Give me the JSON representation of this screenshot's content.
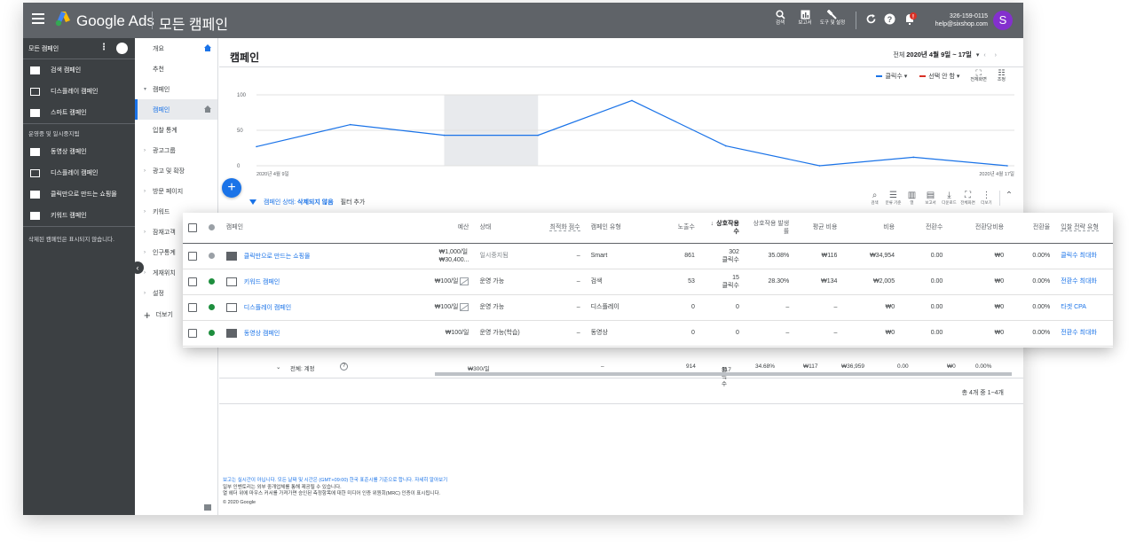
{
  "topbar": {
    "brand": "Google Ads",
    "page": "모든 캠페인",
    "tools": [
      {
        "label": "검색"
      },
      {
        "label": "보고서"
      },
      {
        "label": "도구 및 설정"
      }
    ],
    "account_id": "326-159-0115",
    "account_email": "help@sixshop.com",
    "avatar_letter": "S",
    "colors": {
      "bar": "#5f6368",
      "avatar": "#8430ce",
      "notify": "#d93025"
    }
  },
  "sidebar": {
    "header": "모든 캠페인",
    "items": [
      {
        "label": "검색 캠페인",
        "icon": "search-campaign-icon"
      },
      {
        "label": "디스플레이 캠페인",
        "icon": "display-campaign-icon"
      },
      {
        "label": "스마트 캠페인",
        "icon": "smart-campaign-icon"
      }
    ],
    "section": "운영중 및 일시중지됨",
    "section_items": [
      {
        "label": "동영상 캠페인",
        "icon": "video-campaign-icon"
      },
      {
        "label": "디스플레이 캠페인",
        "icon": "display-campaign-icon"
      },
      {
        "label": "클릭만으로 만드는 쇼핑몰",
        "icon": "smart-campaign-icon"
      },
      {
        "label": "키워드 캠페인",
        "icon": "search-campaign-icon"
      }
    ],
    "note": "삭제된 캠페인은 표시되지 않습니다."
  },
  "nav": {
    "items": [
      {
        "label": "개요",
        "type": "top"
      },
      {
        "label": "추천",
        "type": "top"
      },
      {
        "label": "캠페인",
        "type": "group"
      },
      {
        "label": "캠페인",
        "type": "active"
      },
      {
        "label": "입찰 통계",
        "type": "sub"
      },
      {
        "label": "광고그룹",
        "type": "group"
      },
      {
        "label": "광고 및 확장",
        "type": "group"
      },
      {
        "label": "방문 페이지",
        "type": "group"
      },
      {
        "label": "키워드",
        "type": "group"
      },
      {
        "label": "잠재고객",
        "type": "group"
      },
      {
        "label": "인구통계",
        "type": "group"
      },
      {
        "label": "게재위치",
        "type": "group"
      },
      {
        "label": "설정",
        "type": "group"
      }
    ],
    "more": "더보기"
  },
  "main": {
    "title": "캠페인",
    "date_prefix": "전체",
    "date_range": "2020년 4월 9일 ~ 17일",
    "legend": {
      "metric1": "클릭수",
      "metric2": "선택 안 함",
      "tool1": "전체화면",
      "tool2": "조정"
    },
    "filter_label": "캠페인 상태:",
    "filter_value": "삭제되지 않음",
    "filter_add": "필터 추가",
    "filter_tools": [
      {
        "glyph": "⌕",
        "label": "검색"
      },
      {
        "glyph": "☰",
        "label": "분류 기준"
      },
      {
        "glyph": "▥",
        "label": "열"
      },
      {
        "glyph": "▤",
        "label": "보고서"
      },
      {
        "glyph": "⤓",
        "label": "다운로드"
      },
      {
        "glyph": "⛶",
        "label": "전체화면"
      },
      {
        "glyph": "⋮",
        "label": "더보기"
      }
    ],
    "totals": {
      "label": "전체: 계정",
      "budget": "₩300/일",
      "opt": "–",
      "impr": "914",
      "inter": "317",
      "inter_unit": "클릭수",
      "rate": "34.68%",
      "avg": "₩117",
      "cost": "₩36,959",
      "conv": "0.00",
      "cpc": "₩0",
      "cvr": "0.00%"
    },
    "pager": "총 4개 중 1~4개",
    "footer": {
      "line1": "보고는 실시간이 아닙니다. 모든 날짜 및 시간은 (GMT+09:00) 한국 표준시를 기준으로 합니다.",
      "link": "자세히 알아보기",
      "line2": "일부 인벤토리는 외부 중개업체를 통해 제공될 수 있습니다.",
      "line3": "열 헤더 위에 마우스 커서를 가져가면 승인된 측정항목에 대한 미디어 인증 위원회(MRC) 인증이 표시됩니다.",
      "copyright": "© 2020 Google"
    }
  },
  "chart_data": {
    "type": "line",
    "x": [
      "2020년 4월 9일",
      "4월 10일",
      "4월 11일",
      "4월 12일",
      "4월 13일",
      "4월 14일",
      "4월 15일",
      "4월 16일",
      "2020년 4월 17일"
    ],
    "series": [
      {
        "name": "클릭수",
        "values": [
          27,
          58,
          43,
          43,
          92,
          28,
          0,
          12,
          0
        ]
      }
    ],
    "ylim": [
      0,
      100
    ],
    "yticks": [
      "0",
      "50",
      "100"
    ],
    "xlabel_start": "2020년 4월 9일",
    "xlabel_end": "2020년 4월 17일",
    "highlight_range": [
      2,
      3
    ],
    "line_color": "#1a73e8"
  },
  "table": {
    "headers": [
      "캠페인",
      "예산",
      "상태",
      "최적화 점수",
      "캠페인 유형",
      "노출수",
      "상호작용수",
      "상호작용 발생률",
      "평균 비용",
      "비용",
      "전환수",
      "전환당비용",
      "전환율",
      "입찰 전략 유형"
    ],
    "rows": [
      {
        "status_dot": "#9aa0a6",
        "icon": "smart-campaign-icon",
        "name": "클릭만으로 만드는 쇼핑몰",
        "budget": "₩1,000/일\n₩30,400...",
        "status": "일시중지됨",
        "opt": "–",
        "type": "Smart",
        "impr": "861",
        "inter": "302\n클릭수",
        "rate": "35.08%",
        "avg": "₩116",
        "cost": "₩34,954",
        "conv": "0.00",
        "cpc": "₩0",
        "cvr": "0.00%",
        "strategy": "클릭수 최대화"
      },
      {
        "status_dot": "#1e8e3e",
        "icon": "search-campaign-icon",
        "name": "키워드 캠페인",
        "budget": "₩100/일",
        "status": "운영 가능",
        "opt": "–",
        "type": "검색",
        "impr": "53",
        "inter": "15\n클릭수",
        "rate": "28.30%",
        "avg": "₩134",
        "cost": "₩2,005",
        "conv": "0.00",
        "cpc": "₩0",
        "cvr": "0.00%",
        "strategy": "전환수 최대화"
      },
      {
        "status_dot": "#1e8e3e",
        "icon": "display-campaign-icon",
        "name": "디스플레이 캠페인",
        "budget": "₩100/일",
        "status": "운영 가능",
        "opt": "–",
        "type": "디스플레이",
        "impr": "0",
        "inter": "0",
        "rate": "–",
        "avg": "–",
        "cost": "₩0",
        "conv": "0.00",
        "cpc": "₩0",
        "cvr": "0.00%",
        "strategy": "타겟 CPA"
      },
      {
        "status_dot": "#1e8e3e",
        "icon": "video-campaign-icon",
        "name": "동영상 캠페인",
        "budget": "₩100/일",
        "status": "운영 가능(학습)",
        "opt": "–",
        "type": "동영상",
        "impr": "0",
        "inter": "0",
        "rate": "–",
        "avg": "–",
        "cost": "₩0",
        "conv": "0.00",
        "cpc": "₩0",
        "cvr": "0.00%",
        "strategy": "전환수 최대화"
      }
    ]
  }
}
